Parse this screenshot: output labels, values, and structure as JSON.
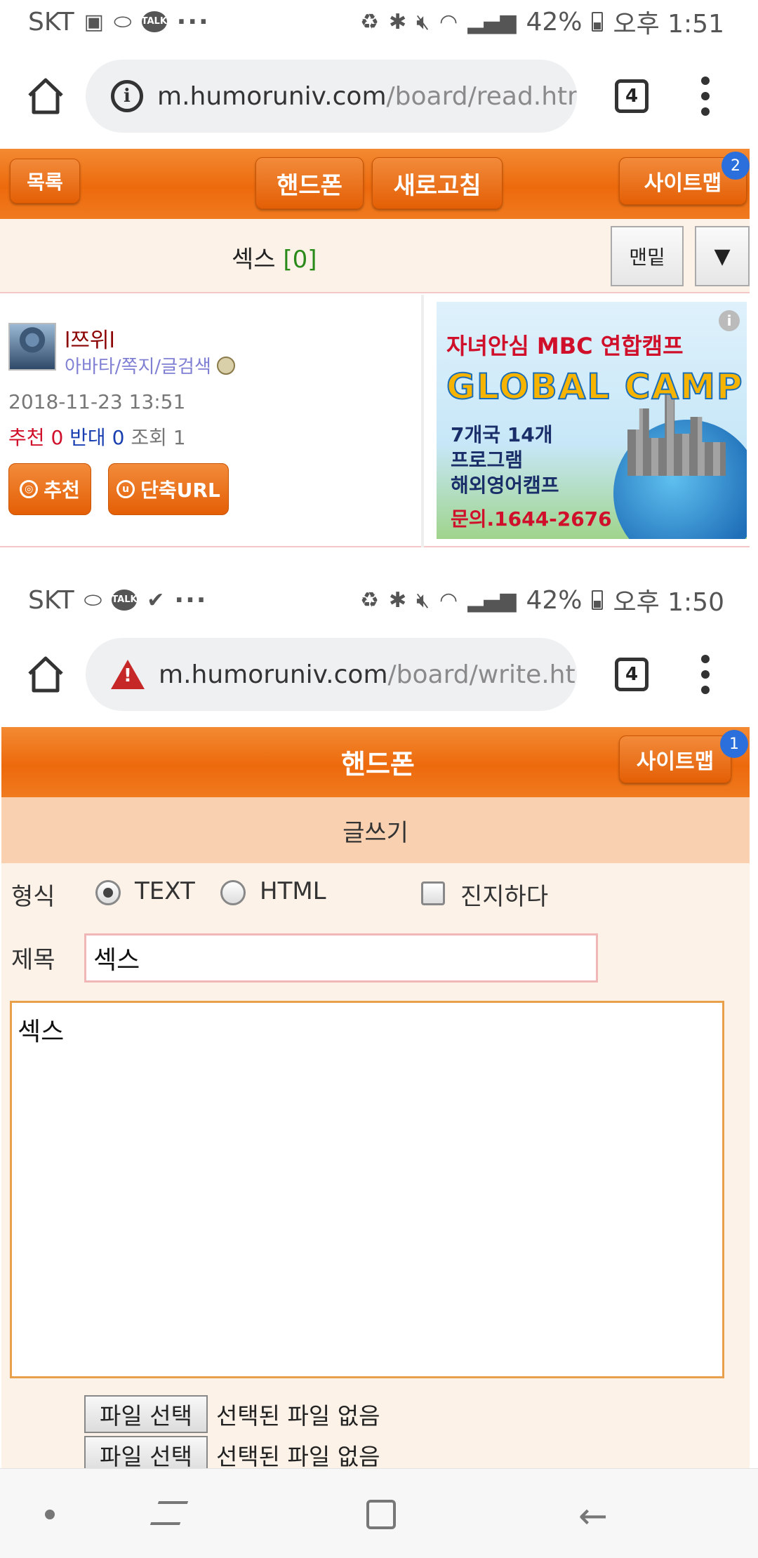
{
  "statusbar_top": {
    "carrier": "SKT",
    "battery_pct": "42%",
    "time": "오후 1:51",
    "more": "···"
  },
  "browser_top": {
    "url_host": "m.humoruniv.com",
    "url_path": "/board/read.htm",
    "tab_count": "4"
  },
  "read_header": {
    "list_btn": "목록",
    "phone_btn": "핸드폰",
    "refresh_btn": "새로고침",
    "sitemap_btn": "사이트맵",
    "sitemap_badge": "2"
  },
  "post": {
    "title": "섹스",
    "comment_count": "[0]",
    "bottom_btn": "맨밑",
    "dropdown_icon": "▼",
    "author": "l쯔위l",
    "author_links": "아바타/쪽지/글검색",
    "datetime": "2018-11-23 13:51",
    "recommend_label": "추천",
    "recommend_count": "0",
    "oppose_label": "반대",
    "oppose_count": "0",
    "views_label": "조회",
    "views_count": "1",
    "recommend_btn": "추천",
    "shorturl_btn": "단축URL"
  },
  "ad": {
    "line1": "자녀안심 MBC 연합캠프",
    "line2": "GLOBAL CAMP",
    "line3a": "7개국 14개",
    "line3b": "프로그램",
    "line3c": "해외영어캠프",
    "contact": "문의.1644-2676",
    "info": "i"
  },
  "statusbar_bottom": {
    "carrier": "SKT",
    "battery_pct": "42%",
    "time": "오후 1:50",
    "more": "···"
  },
  "browser_bottom": {
    "url_host": "m.humoruniv.com",
    "url_path": "/board/write.htm",
    "tab_count": "4"
  },
  "write_header": {
    "title": "핸드폰",
    "sitemap_btn": "사이트맵",
    "sitemap_badge": "1",
    "subheader": "글쓰기"
  },
  "write_form": {
    "format_label": "형식",
    "format_text": "TEXT",
    "format_html": "HTML",
    "serious_label": "진지하다",
    "subject_label": "제목",
    "subject_value": "섹스",
    "body_value": "섹스",
    "file_btn_1": "파일 선택",
    "file_status_1": "선택된 파일 없음",
    "file_btn_2": "파일 선택",
    "file_status_2": "선택된 파일 없음"
  },
  "colors": {
    "accent_orange": "#ed6a0c",
    "badge_blue": "#2a6fdb",
    "recommend_red": "#d0102a",
    "oppose_blue": "#1a3fb0",
    "comment_green": "#2a8a1a"
  }
}
